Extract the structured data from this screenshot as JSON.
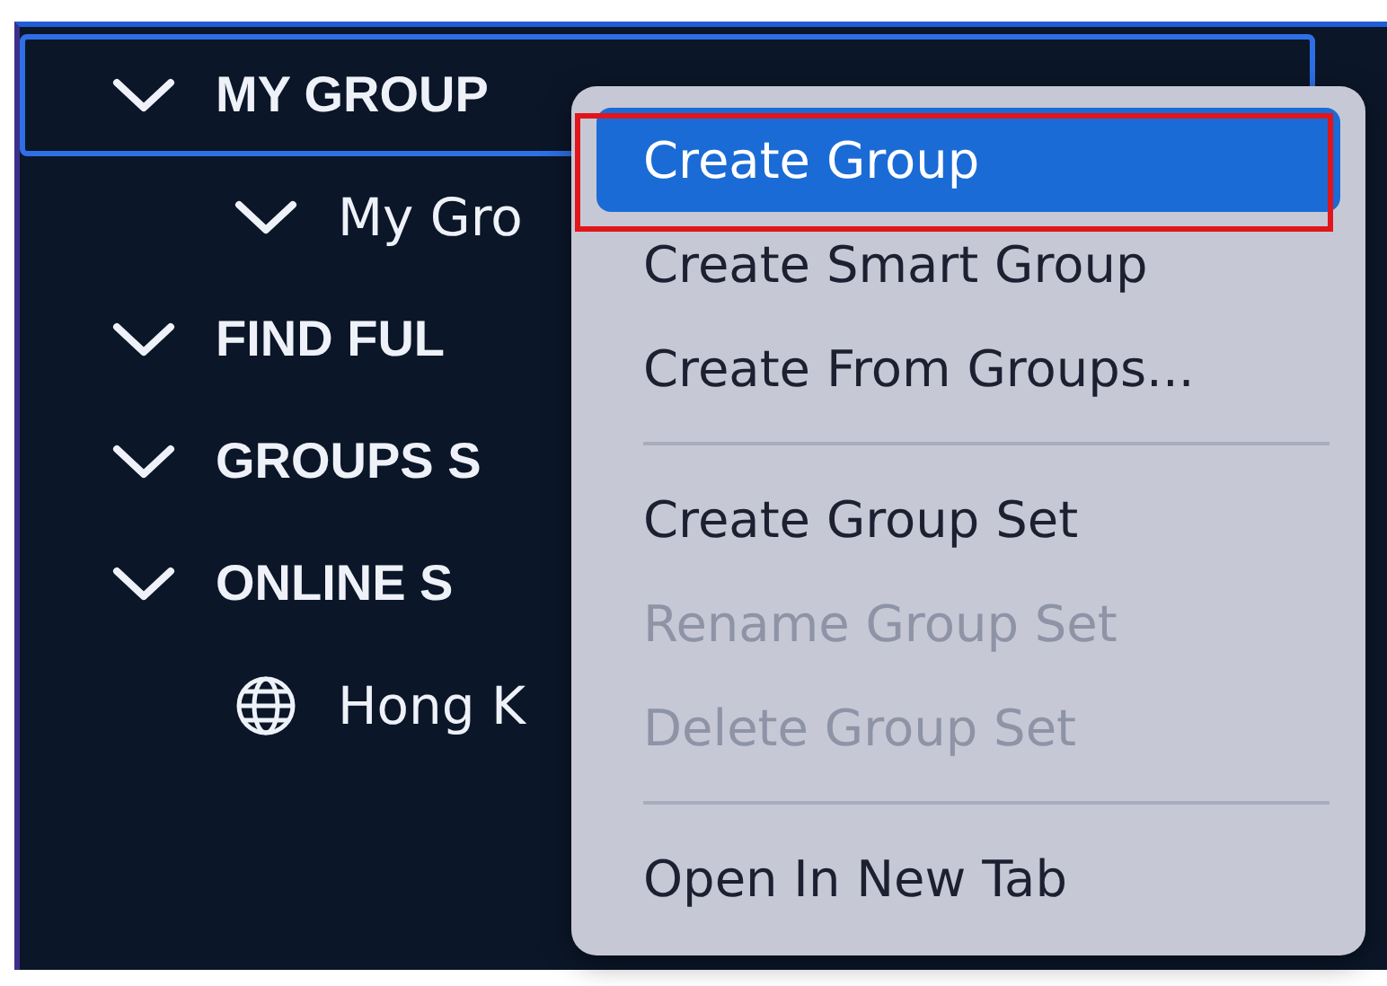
{
  "sidebar": {
    "items": [
      {
        "kind": "section",
        "label": "MY GROUP",
        "expanded": true,
        "focused": true,
        "children": [
          {
            "kind": "group",
            "label": "My Gro",
            "expanded": true,
            "focused": false
          }
        ]
      },
      {
        "kind": "section",
        "label": "FIND FUL",
        "expanded": true,
        "focused": false
      },
      {
        "kind": "section",
        "label": "GROUPS S",
        "expanded": true,
        "focused": false
      },
      {
        "kind": "section",
        "label": "ONLINE S",
        "expanded": true,
        "focused": false,
        "children": [
          {
            "kind": "site",
            "label": "Hong K",
            "focused": false
          }
        ]
      }
    ]
  },
  "context_menu": {
    "sections": [
      [
        {
          "label": "Create Group",
          "selected": true,
          "disabled": false,
          "outlined": true
        },
        {
          "label": "Create Smart Group",
          "selected": false,
          "disabled": false,
          "outlined": false
        },
        {
          "label": "Create From Groups...",
          "selected": false,
          "disabled": false,
          "outlined": false
        }
      ],
      [
        {
          "label": "Create Group Set",
          "selected": false,
          "disabled": false,
          "outlined": false
        },
        {
          "label": "Rename Group Set",
          "selected": false,
          "disabled": true,
          "outlined": false
        },
        {
          "label": "Delete Group Set",
          "selected": false,
          "disabled": true,
          "outlined": false
        }
      ],
      [
        {
          "label": "Open In New Tab",
          "selected": false,
          "disabled": false,
          "outlined": false
        }
      ]
    ]
  }
}
